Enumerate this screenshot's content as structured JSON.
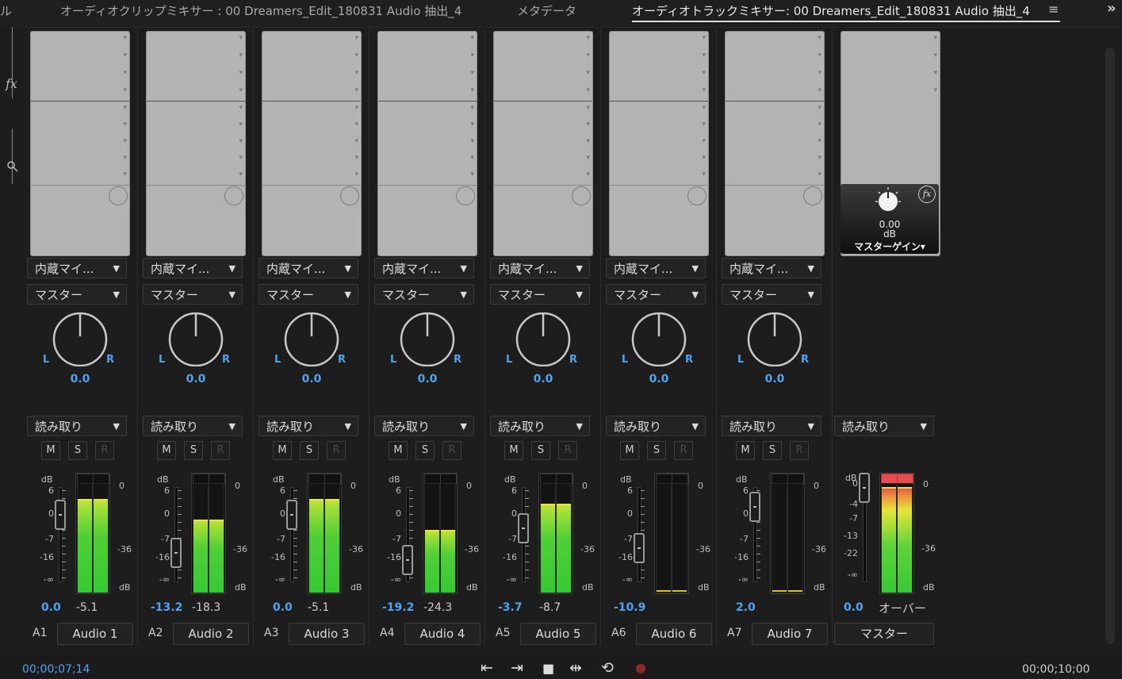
{
  "tabs": {
    "partial_left": "ル",
    "clip_mixer": "オーディオクリップミキサー : 00 Dreamers_Edit_180831 Audio 抽出_4",
    "metadata": "メタデータ",
    "track_mixer": "オーディオトラックミキサー: 00 Dreamers_Edit_180831 Audio 抽出_4",
    "menu_icon": "≡",
    "more_icon": "»"
  },
  "left_strip": {
    "fx": "fx"
  },
  "channels": [
    {
      "id": "A1",
      "name": "Audio 1",
      "input": "内蔵マイ...",
      "output": "マスター",
      "pan": "0.0",
      "automation": "読み取り",
      "volume": "0.0",
      "peak": "-5.1",
      "level_left": 0.86,
      "level_right": 0.86
    },
    {
      "id": "A2",
      "name": "Audio 2",
      "input": "内蔵マイ...",
      "output": "マスター",
      "pan": "0.0",
      "automation": "読み取り",
      "volume": "-13.2",
      "peak": "-18.3",
      "level_left": 0.67,
      "level_right": 0.67
    },
    {
      "id": "A3",
      "name": "Audio 3",
      "input": "内蔵マイ...",
      "output": "マスター",
      "pan": "0.0",
      "automation": "読み取り",
      "volume": "0.0",
      "peak": "-5.1",
      "level_left": 0.86,
      "level_right": 0.86
    },
    {
      "id": "A4",
      "name": "Audio 4",
      "input": "内蔵マイ...",
      "output": "マスター",
      "pan": "0.0",
      "automation": "読み取り",
      "volume": "-19.2",
      "peak": "-24.3",
      "level_left": 0.58,
      "level_right": 0.58
    },
    {
      "id": "A5",
      "name": "Audio 5",
      "input": "内蔵マイ...",
      "output": "マスター",
      "pan": "0.0",
      "automation": "読み取り",
      "volume": "-3.7",
      "peak": "-8.7",
      "level_left": 0.82,
      "level_right": 0.82
    },
    {
      "id": "A6",
      "name": "Audio 6",
      "input": "内蔵マイ...",
      "output": "マスター",
      "pan": "0.0",
      "automation": "読み取り",
      "volume": "-10.9",
      "peak": "",
      "level_left": 0.0,
      "level_right": 0.0
    },
    {
      "id": "A7",
      "name": "Audio 7",
      "input": "内蔵マイ...",
      "output": "マスター",
      "pan": "0.0",
      "automation": "読み取り",
      "volume": "2.0",
      "peak": "",
      "level_left": 0.0,
      "level_right": 0.0
    }
  ],
  "buttons": {
    "mute": "M",
    "solo": "S",
    "record": "R"
  },
  "fader_scale": {
    "db": "dB",
    "t6": "6",
    "t0": "0",
    "tm7": "-7",
    "tm16": "-16",
    "tinf": "-∞"
  },
  "meter_scale": {
    "t0": "0",
    "tm36": "-36",
    "db": "dB"
  },
  "pan_labels": {
    "left": "L",
    "right": "R"
  },
  "master": {
    "name": "マスター",
    "gain_value": "0.00",
    "gain_unit": "dB",
    "gain_label": "マスターゲイン",
    "automation": "読み取り",
    "volume": "0.0",
    "peak": "オーバー",
    "fader_scale": {
      "db": "dB",
      "t0": "0",
      "tm4": "-4",
      "tm7": "-7",
      "tm13": "-13",
      "tm22": "-22",
      "tinf": "-∞"
    },
    "level": 0.97
  },
  "transport": {
    "timecode_current": "00;00;07;14",
    "timecode_end": "00;00;10;00"
  },
  "colors": {
    "accent": "#4ea4f0",
    "meter_green": "#36c934",
    "meter_yellow": "#e6e636",
    "meter_red": "#e84c4c"
  }
}
